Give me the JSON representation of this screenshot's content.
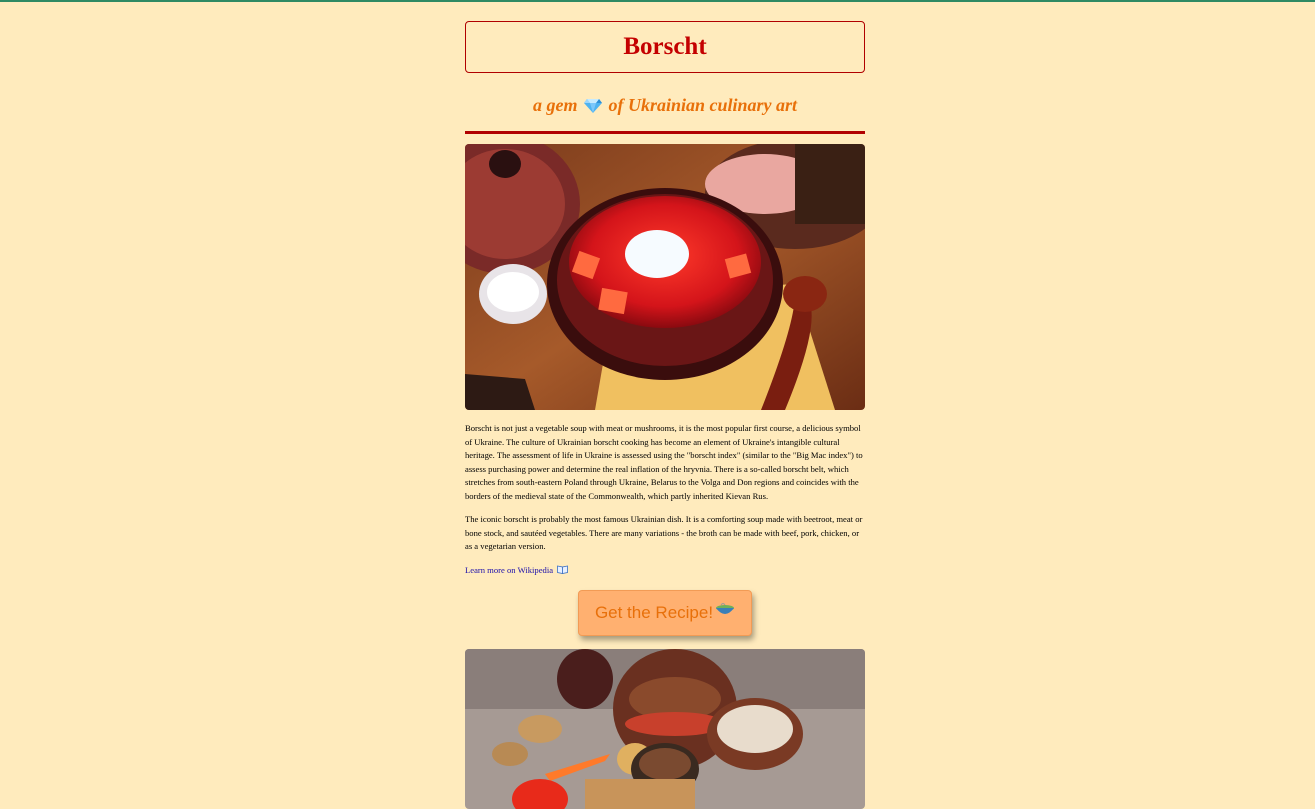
{
  "header": {
    "title": "Borscht",
    "subtitle_before": "a gem",
    "subtitle_icon": "gem-icon",
    "subtitle_after": "of Ukrainian culinary art"
  },
  "article": {
    "paragraphs": [
      "Borscht is not just a vegetable soup with meat or mushrooms, it is the most popular first course, a delicious symbol of Ukraine. The culture of Ukrainian borscht cooking has become an element of Ukraine's intangible cultural heritage. The assessment of life in Ukraine is assessed using the \"borscht index\" (similar to the \"Big Mac index\") to assess purchasing power and determine the real inflation of the hryvnia. There is a so-called borscht belt, which stretches from south-eastern Poland through Ukraine, Belarus to the Volga and Don regions and coincides with the borders of the medieval state of the Commonwealth, which partly inherited Kievan Rus.",
      "The iconic borscht is probably the most famous Ukrainian dish. It is a comforting soup made with beetroot, meat or bone stock, and sautéed vegetables. There are many variations - the broth can be made with beef, pork, chicken, or as a vegetarian version."
    ],
    "wiki_link": "Learn more on Wikipedia",
    "wiki_icon": "book-icon"
  },
  "cta": {
    "label": "Get the Recipe!",
    "icon": "soup-bowl-icon"
  },
  "colors": {
    "background": "#ffebbd",
    "title": "#c40000",
    "subtitle": "#e8700a",
    "divider": "#b00000",
    "link": "#1a0dab",
    "button": "#ffb070"
  }
}
